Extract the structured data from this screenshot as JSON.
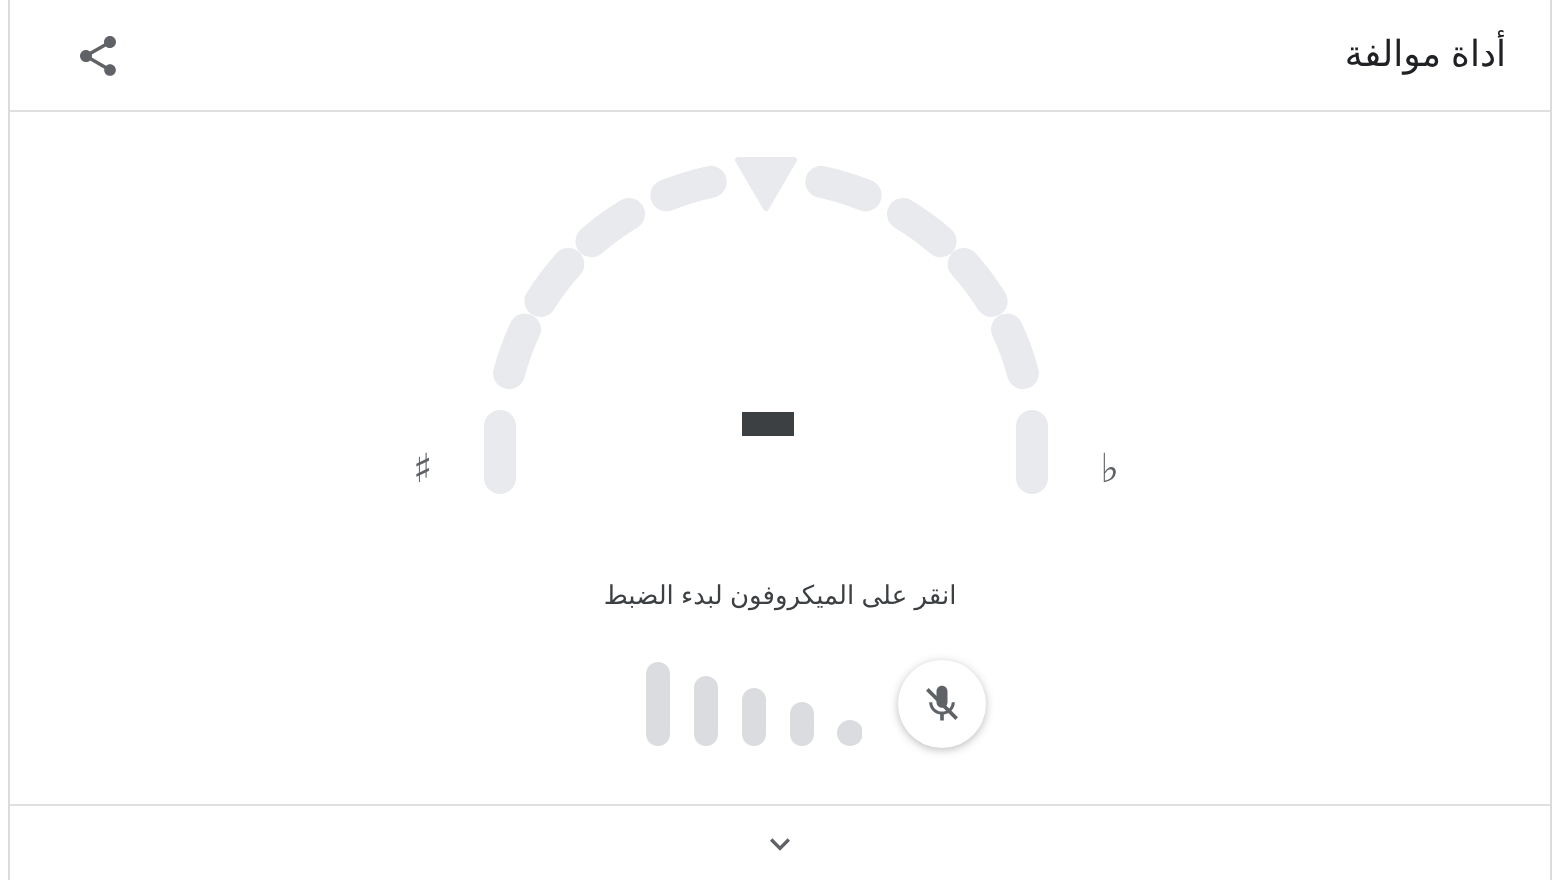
{
  "header": {
    "title": "أداة موالفة"
  },
  "gauge": {
    "sharp_label": "♯",
    "flat_label": "♭"
  },
  "instruction": "انقر على الميكروفون لبدء الضبط",
  "microphone": {
    "muted": true
  }
}
